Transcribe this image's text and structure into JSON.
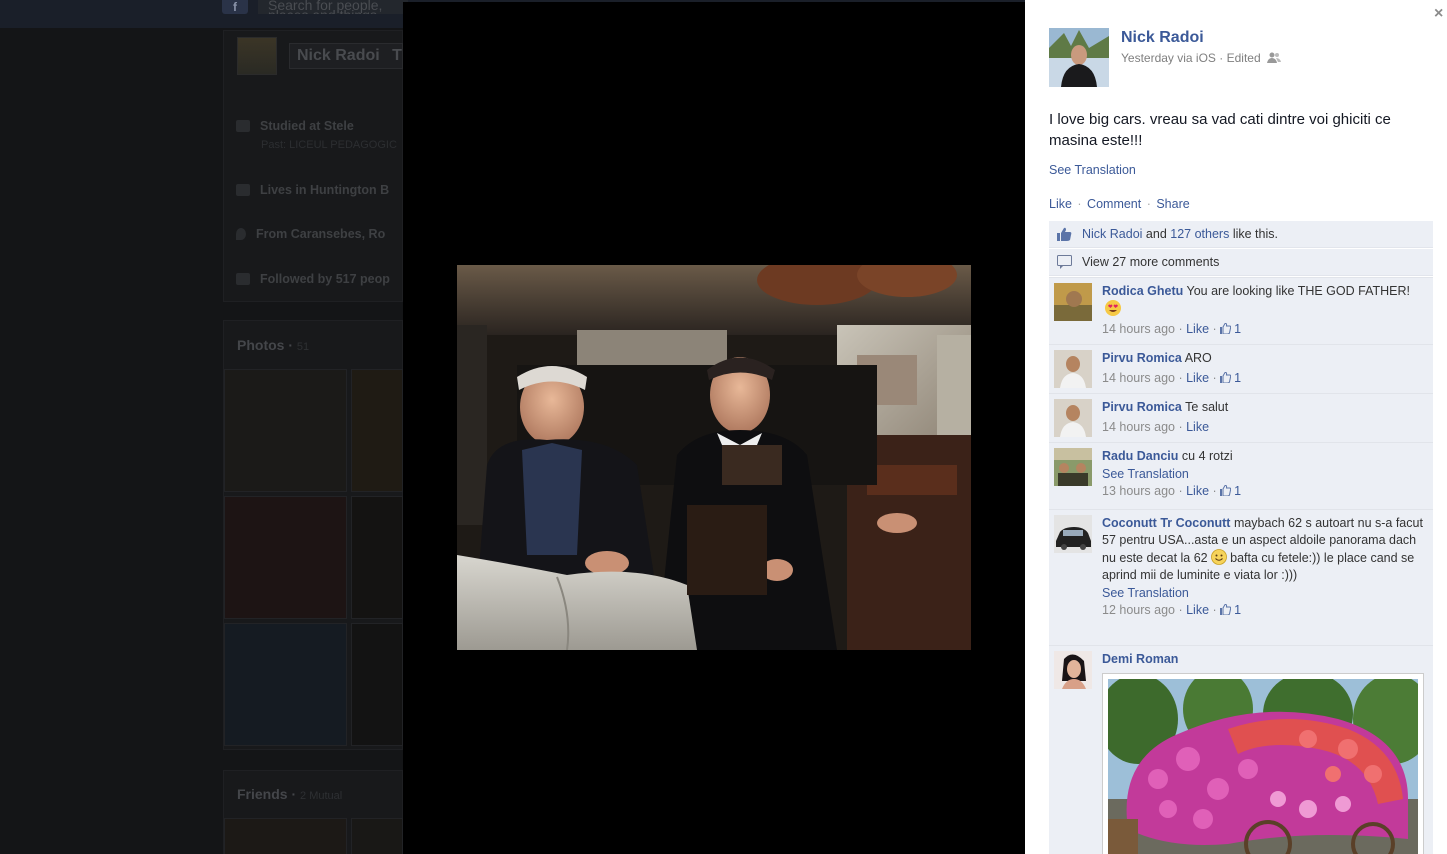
{
  "background_page": {
    "search_placeholder": "Search for people, places and things",
    "profile_name": "Nick Radoi",
    "profile_name_cut": "T",
    "studied": "Studied at Stele",
    "studied_sub": "Past: LICEUL PEDAGOGIC",
    "lives": "Lives in Huntington B",
    "from": "From Caransebes, Ro",
    "followed": "Followed by 517 peop",
    "photos_title": "Photos",
    "photos_count": "51",
    "friends_title": "Friends",
    "friends_count": "2 Mutual"
  },
  "post": {
    "author": "Nick Radoi",
    "meta": "Yesterday via iOS · Edited",
    "text": "I love big cars. vreau sa vad cati dintre voi ghiciti ce masina este!!!",
    "see_translation": "See Translation",
    "actions": {
      "like": "Like",
      "comment": "Comment",
      "share": "Share"
    },
    "close": "×"
  },
  "likes": {
    "name": "Nick Radoi",
    "and": "and",
    "others": "127 others",
    "suffix": "like this."
  },
  "view_more": "View 27 more comments",
  "comments": [
    {
      "name": "Rodica Ghetu",
      "text": "You are looking like THE GOD FATHER!",
      "time": "14 hours ago",
      "like": "Like",
      "likes": "1"
    },
    {
      "name": "Pirvu Romica",
      "text": "ARO",
      "time": "14 hours ago",
      "like": "Like",
      "likes": "1"
    },
    {
      "name": "Pirvu Romica",
      "text": "Te salut",
      "time": "14 hours ago",
      "like": "Like",
      "likes": ""
    },
    {
      "name": "Radu Danciu",
      "text": "cu 4 rotzi",
      "translation": "See Translation",
      "time": "13 hours ago",
      "like": "Like",
      "likes": "1"
    },
    {
      "name": "Coconutt Tr Coconutt",
      "text1": "maybach 62 s autoart nu s-a facut 57 pentru USA...asta e un aspect aldoile panorama dach nu este decat la 62",
      "text2": "bafta cu fetele:)) le place cand se aprind mii de luminite e viata lor :)))",
      "translation": "See Translation",
      "time": "12 hours ago",
      "like": "Like",
      "likes": "1"
    },
    {
      "name": "Demi Roman"
    }
  ],
  "colors": {
    "link": "#3b5998",
    "ufi_bg": "#eceff5",
    "theater_bg": "#000000"
  }
}
